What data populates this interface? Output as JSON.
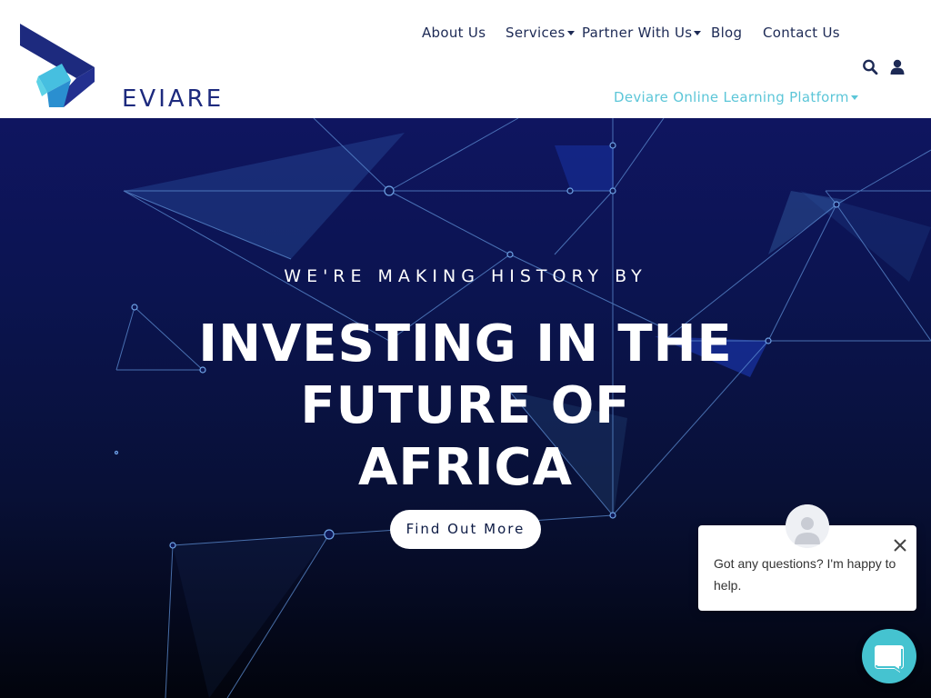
{
  "brand": {
    "name": "EVIARE",
    "logo_icon": "deviare-d-logo-icon",
    "primary_color": "#1d2a7e",
    "accent_color": "#5cc6d8"
  },
  "nav": {
    "items": [
      {
        "label": "About Us",
        "has_dropdown": false
      },
      {
        "label": "Services",
        "has_dropdown": true
      },
      {
        "label": "Partner With Us",
        "has_dropdown": true
      },
      {
        "label": "Blog",
        "has_dropdown": false
      },
      {
        "label": "Contact Us",
        "has_dropdown": false
      }
    ],
    "secondary": {
      "label": "Deviare Online Learning Platform",
      "has_dropdown": true
    },
    "icons": [
      "search-icon",
      "user-icon"
    ]
  },
  "hero": {
    "eyebrow": "WE'RE MAKING HISTORY BY",
    "title_lines": [
      "INVESTING IN THE",
      "FUTURE OF",
      "AFRICA"
    ],
    "cta_label": "Find Out More"
  },
  "chat": {
    "message": "Got any questions? I'm happy to help.",
    "close_icon": "close-icon",
    "launcher_icon": "chat-icon",
    "launcher_color": "#45c3d0"
  }
}
